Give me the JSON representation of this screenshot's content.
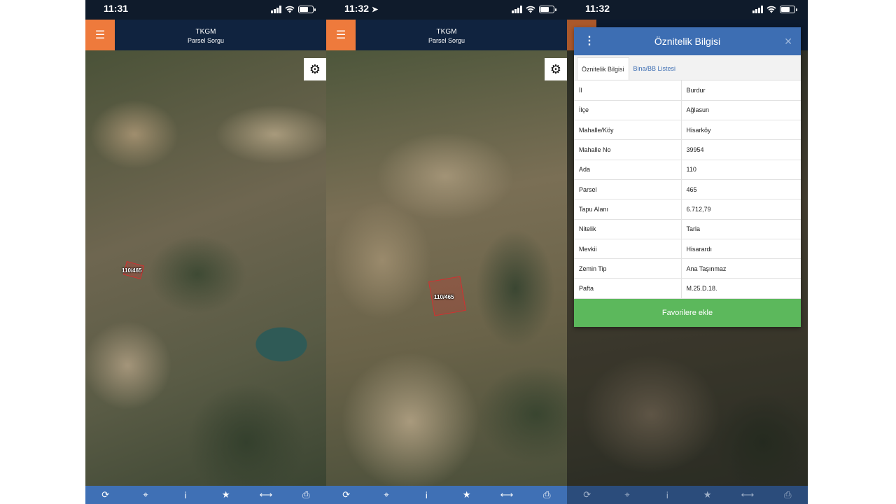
{
  "screens": [
    {
      "time": "11:31",
      "location_icon": "",
      "header": {
        "title": "TKGM",
        "subtitle": "Parsel Sorgu"
      },
      "parcel_label": "110/465"
    },
    {
      "time": "11:32",
      "location_icon": "➤",
      "header": {
        "title": "TKGM",
        "subtitle": "Parsel Sorgu"
      },
      "parcel_label": "110/465"
    },
    {
      "time": "11:32",
      "location_icon": ""
    }
  ],
  "bottom_icons": [
    "refresh-icon",
    "locate-icon",
    "info-icon",
    "star-icon",
    "measure-icon",
    "print-icon"
  ],
  "bottom_glyphs": [
    "⟳",
    "⌖",
    "i",
    "★",
    "⟷",
    "⎙"
  ],
  "modal": {
    "title": "Öznitelik Bilgisi",
    "close": "✕",
    "kebab": "⋮",
    "tabs": [
      {
        "label": "Öznitelik Bilgisi",
        "active": true
      },
      {
        "label": "Bina/BB Listesi",
        "active": false
      }
    ],
    "rows": [
      {
        "key": "İl",
        "value": "Burdur"
      },
      {
        "key": "İlçe",
        "value": "Ağlasun"
      },
      {
        "key": "Mahalle/Köy",
        "value": "Hisarköy"
      },
      {
        "key": "Mahalle No",
        "value": "39954"
      },
      {
        "key": "Ada",
        "value": "110"
      },
      {
        "key": "Parsel",
        "value": "465"
      },
      {
        "key": "Tapu Alanı",
        "value": "6.712,79"
      },
      {
        "key": "Nitelik",
        "value": "Tarla"
      },
      {
        "key": "Mevkii",
        "value": "Hisarardı"
      },
      {
        "key": "Zemin Tip",
        "value": "Ana Taşınmaz"
      },
      {
        "key": "Pafta",
        "value": "M.25.D.18."
      }
    ],
    "favorite_button": "Favorilere ekle"
  },
  "colors": {
    "accent_orange": "#ee7a3c",
    "header_navy": "#10233f",
    "modal_blue": "#3d6eb3",
    "favorite_green": "#5cb85c",
    "parcel_red": "#d23030"
  }
}
